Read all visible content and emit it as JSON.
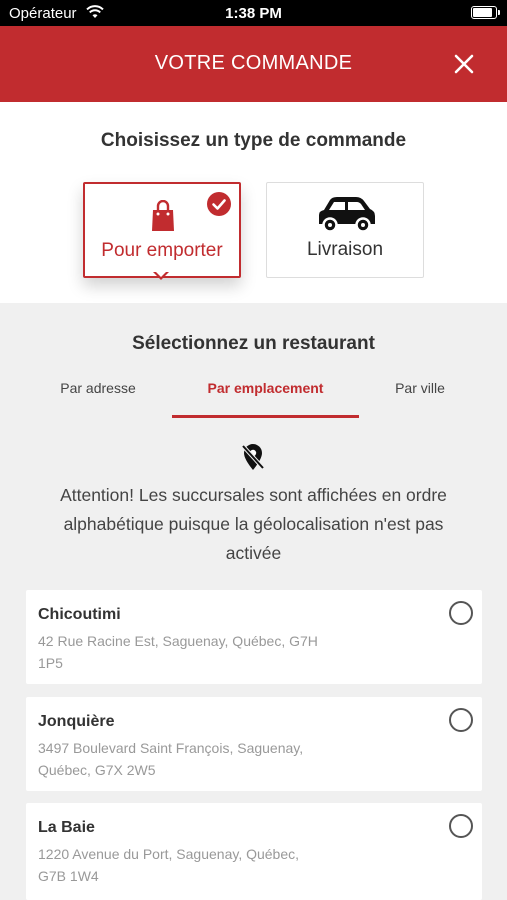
{
  "status_bar": {
    "carrier": "Opérateur",
    "time": "1:38 PM"
  },
  "header": {
    "title": "VOTRE COMMANDE"
  },
  "order_type": {
    "heading": "Choisissez un type de commande",
    "options": [
      {
        "label": "Pour emporter",
        "selected": true,
        "icon": "shopping-bag-icon"
      },
      {
        "label": "Livraison",
        "selected": false,
        "icon": "car-icon"
      }
    ]
  },
  "restaurant": {
    "heading": "Sélectionnez un restaurant",
    "tabs": [
      {
        "label": "Par adresse",
        "active": false
      },
      {
        "label": "Par emplacement",
        "active": true
      },
      {
        "label": "Par ville",
        "active": false
      }
    ],
    "warning": "Attention! Les succursales sont affichées en ordre alphabétique puisque la géolocalisation n'est pas activée",
    "branches": [
      {
        "name": "Chicoutimi",
        "address": "42 Rue Racine Est, Saguenay, Québec, G7H 1P5",
        "selected": false
      },
      {
        "name": "Jonquière",
        "address": "3497 Boulevard Saint François, Saguenay, Québec, G7X 2W5",
        "selected": false
      },
      {
        "name": "La Baie",
        "address": "1220 Avenue du Port, Saguenay, Québec, G7B 1W4",
        "selected": false
      }
    ]
  },
  "colors": {
    "brand_red": "#c12c2f",
    "background": "#f0f0f0"
  }
}
